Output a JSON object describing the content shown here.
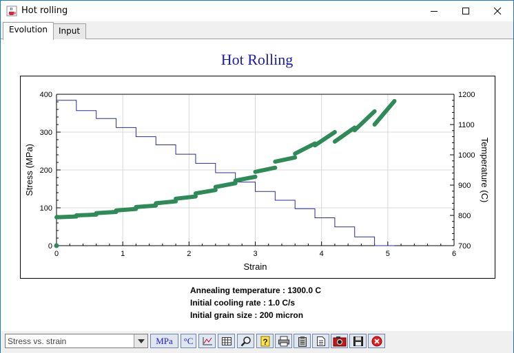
{
  "window": {
    "title": "Hot rolling",
    "controls": {
      "minimize": "minimize",
      "maximize": "maximize",
      "close": "close"
    }
  },
  "tabs": [
    {
      "label": "Evolution",
      "active": true
    },
    {
      "label": "Input",
      "active": false
    }
  ],
  "chart_data": {
    "type": "line",
    "title": "Hot Rolling",
    "xlabel": "Strain",
    "ylabel": "Stress (MPa)",
    "y2label": "Temperature (C)",
    "xlim": [
      0,
      6
    ],
    "ylim": [
      0,
      400
    ],
    "y2lim": [
      700,
      1200
    ],
    "x_ticks": [
      "0",
      "1",
      "2",
      "3",
      "4",
      "5",
      "6"
    ],
    "y_ticks": [
      "0",
      "100",
      "200",
      "300",
      "400"
    ],
    "y2_ticks": [
      "700",
      "800",
      "900",
      "1000",
      "1100",
      "1200"
    ],
    "grid": true,
    "colors": {
      "stress": "#2e8b57",
      "temperature": "#2a2a9a",
      "title": "#1a1aa8"
    },
    "series": [
      {
        "axis": "left",
        "passes": [
          {
            "x": [
              0.0,
              0.3
            ],
            "y": [
              75,
              77
            ]
          },
          {
            "x": [
              0.3,
              0.6
            ],
            "y": [
              80,
              82
            ]
          },
          {
            "x": [
              0.6,
              0.9
            ],
            "y": [
              86,
              89
            ]
          },
          {
            "x": [
              0.9,
              1.2
            ],
            "y": [
              93,
              97
            ]
          },
          {
            "x": [
              1.2,
              1.5
            ],
            "y": [
              102,
              106
            ]
          },
          {
            "x": [
              1.5,
              1.8
            ],
            "y": [
              112,
              117
            ]
          },
          {
            "x": [
              1.8,
              2.1
            ],
            "y": [
              124,
              130
            ]
          },
          {
            "x": [
              2.1,
              2.4
            ],
            "y": [
              138,
              147
            ]
          },
          {
            "x": [
              2.4,
              2.7
            ],
            "y": [
              155,
              165
            ]
          },
          {
            "x": [
              2.7,
              3.0
            ],
            "y": [
              172,
              182
            ]
          },
          {
            "x": [
              3.0,
              3.3
            ],
            "y": [
              195,
              206
            ]
          },
          {
            "x": [
              3.3,
              3.6
            ],
            "y": [
              222,
              233
            ]
          },
          {
            "x": [
              3.6,
              3.9
            ],
            "y": [
              243,
              270
            ]
          },
          {
            "x": [
              3.9,
              4.2
            ],
            "y": [
              265,
              300
            ]
          },
          {
            "x": [
              4.2,
              4.5
            ],
            "y": [
              275,
              312
            ]
          },
          {
            "x": [
              4.5,
              4.8
            ],
            "y": [
              305,
              355
            ]
          },
          {
            "x": [
              4.8,
              5.1
            ],
            "y": [
              320,
              382
            ]
          }
        ],
        "start_point": {
          "x": 0,
          "y": 0
        }
      },
      {
        "axis": "right",
        "steps": [
          {
            "x0": 0.0,
            "x1": 0.3,
            "y": 1180
          },
          {
            "x0": 0.3,
            "x1": 0.6,
            "y": 1146
          },
          {
            "x0": 0.6,
            "x1": 0.9,
            "y": 1120
          },
          {
            "x0": 0.9,
            "x1": 1.2,
            "y": 1090
          },
          {
            "x0": 1.2,
            "x1": 1.5,
            "y": 1060
          },
          {
            "x0": 1.5,
            "x1": 1.8,
            "y": 1033
          },
          {
            "x0": 1.8,
            "x1": 2.1,
            "y": 1002
          },
          {
            "x0": 2.1,
            "x1": 2.4,
            "y": 972
          },
          {
            "x0": 2.4,
            "x1": 2.7,
            "y": 941
          },
          {
            "x0": 2.7,
            "x1": 3.0,
            "y": 910
          },
          {
            "x0": 3.0,
            "x1": 3.3,
            "y": 879
          },
          {
            "x0": 3.3,
            "x1": 3.6,
            "y": 850
          },
          {
            "x0": 3.6,
            "x1": 3.9,
            "y": 822
          },
          {
            "x0": 3.9,
            "x1": 4.2,
            "y": 792
          },
          {
            "x0": 4.2,
            "x1": 4.5,
            "y": 762
          },
          {
            "x0": 4.5,
            "x1": 4.8,
            "y": 729
          },
          {
            "x0": 4.8,
            "x1": 5.1,
            "y": 700
          }
        ]
      }
    ]
  },
  "info": [
    "Annealing temperature : 1300.0 C",
    "Initial cooling rate : 1.0 C/s",
    "Initial grain size : 200 micron"
  ],
  "bottombar": {
    "plot_select": {
      "value": "Stress vs. strain"
    },
    "buttons": [
      {
        "name": "units-mpa-button",
        "label": "MPa",
        "icon": "text"
      },
      {
        "name": "units-celsius-button",
        "label": "°C",
        "icon": "text"
      },
      {
        "name": "axes-button",
        "label": "",
        "icon": "axes-icon"
      },
      {
        "name": "grid-button",
        "label": "",
        "icon": "grid-icon"
      },
      {
        "name": "zoom-button",
        "label": "",
        "icon": "magnifier-icon"
      },
      {
        "name": "help-button",
        "label": "",
        "icon": "question-icon"
      },
      {
        "name": "print-button",
        "label": "",
        "icon": "printer-icon"
      },
      {
        "name": "clipboard-button",
        "label": "",
        "icon": "clipboard-icon"
      },
      {
        "name": "document-button",
        "label": "",
        "icon": "document-icon"
      },
      {
        "name": "camera-button",
        "label": "",
        "icon": "camera-icon"
      },
      {
        "name": "save-button",
        "label": "",
        "icon": "floppy-icon"
      },
      {
        "name": "close-plot-button",
        "label": "",
        "icon": "stop-icon"
      }
    ]
  }
}
